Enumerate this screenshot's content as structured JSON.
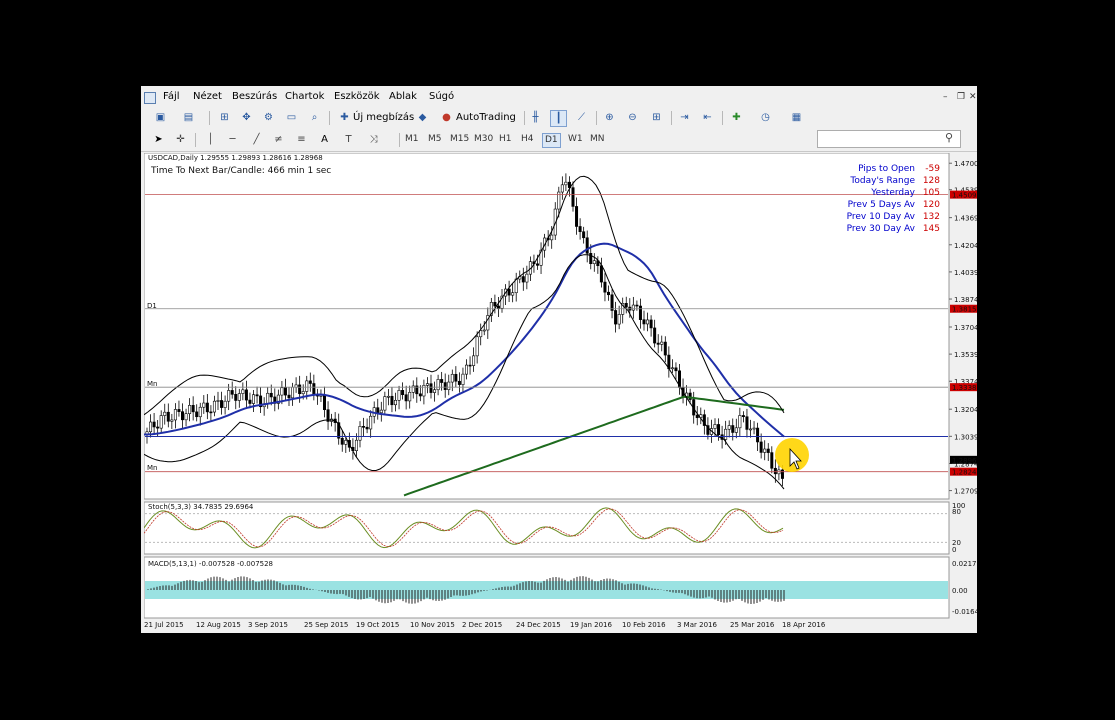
{
  "menu": {
    "items": [
      "Fájl",
      "Nézet",
      "Beszúrás",
      "Chartok",
      "Eszközök",
      "Ablak",
      "Súgó"
    ]
  },
  "toolbar": {
    "new_order_label": "Új megbízás",
    "autotrading_label": "AutoTrading",
    "timeframes": [
      "M1",
      "M5",
      "M15",
      "M30",
      "H1",
      "H4",
      "D1",
      "W1",
      "MN"
    ],
    "active_timeframe": "D1"
  },
  "chart": {
    "header": "USDCAD,Daily  1.29555 1.29893 1.28616 1.28968",
    "timer": "Time To Next Bar/Candle: 466 min 1 sec",
    "stats": [
      {
        "label": "Pips to Open",
        "value": "-59"
      },
      {
        "label": "Today's Range",
        "value": "128"
      },
      {
        "label": "Yesterday",
        "value": "105"
      },
      {
        "label": "Prev 5 Days Av",
        "value": "120"
      },
      {
        "label": "Prev 10 Day Av",
        "value": "132"
      },
      {
        "label": "Prev 30 Day Av",
        "value": "145"
      }
    ],
    "level_labels": [
      "D1",
      "Mn",
      "Mn"
    ],
    "price_ticks": [
      "1.4700",
      "1.4539",
      "1.4369",
      "1.4204",
      "1.4039",
      "1.3874",
      "1.3704",
      "1.3539",
      "1.3374",
      "1.3204",
      "1.3039",
      "1.2874",
      "1.2709"
    ],
    "price_tags": [
      {
        "price": 1.4509,
        "label": "1.4509",
        "color": "#cc0000"
      },
      {
        "price": 1.3815,
        "label": "1.3815",
        "color": "#cc0000"
      },
      {
        "price": 1.3338,
        "label": "1.3338",
        "color": "#cc0000"
      },
      {
        "price": 1.2896,
        "label": "1.2896",
        "color": "#000000"
      },
      {
        "price": 1.2824,
        "label": "1.2824",
        "color": "#cc0000"
      }
    ],
    "price_range": [
      1.267,
      1.475
    ],
    "stoch": {
      "label": "Stoch(5,3,3) 34.7835 29.6964",
      "ticks": [
        "100",
        "80",
        "20",
        "0"
      ]
    },
    "macd": {
      "label": "MACD(5,13,1) -0.007528 -0.007528",
      "ticks": [
        "0.0217",
        "0.00",
        "-0.0164"
      ]
    },
    "date_labels": [
      "21 Jul 2015",
      "12 Aug 2015",
      "3 Sep 2015",
      "25 Sep 2015",
      "19 Oct 2015",
      "10 Nov 2015",
      "2 Dec 2015",
      "24 Dec 2015",
      "19 Jan 2016",
      "10 Feb 2016",
      "3 Mar 2016",
      "25 Mar 2016",
      "18 Apr 2016"
    ],
    "colors": {
      "bull": "#ffffff",
      "bear": "#000000",
      "ma_blue": "#1f2fa8",
      "ma_green": "#1e6b1e",
      "stats_blue": "#0000cc",
      "stats_red": "#cc0000",
      "macd_cyan": "#6fd6d6",
      "cursor_highlight": "#ffd400"
    }
  }
}
